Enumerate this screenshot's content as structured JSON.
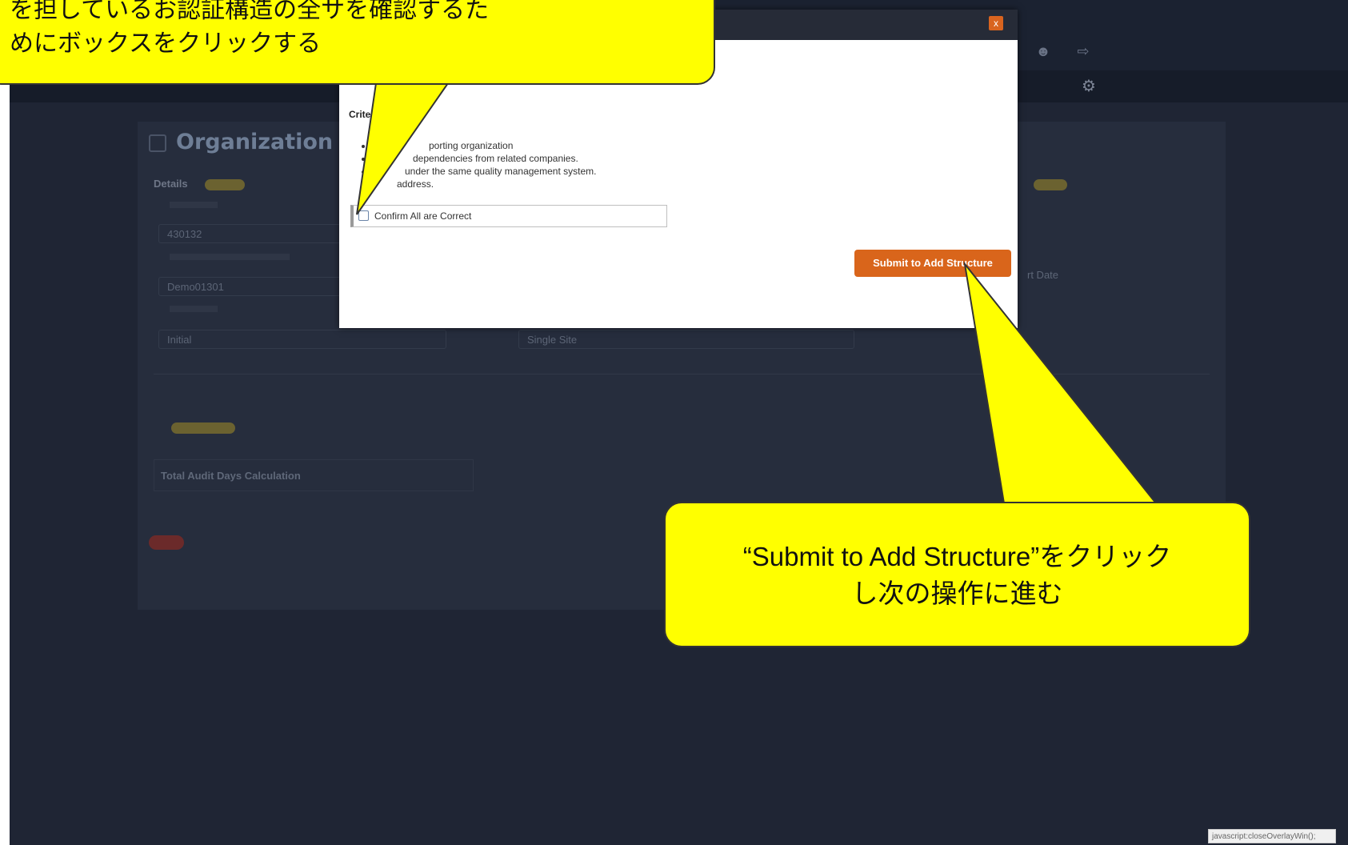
{
  "app": {
    "topbar_user": "",
    "panel_title": "Organization Aud",
    "details_label": "Details",
    "details_badge": "",
    "fields": [
      {
        "label": "",
        "value": "430132"
      },
      {
        "label": "",
        "value": "Demo01301"
      },
      {
        "label": "",
        "value": "Initial"
      }
    ],
    "single_site_value": "Single Site",
    "calc_label": "Total Audit Days Calculation",
    "right_text": "rt Date",
    "status_tooltip": "javascript:closeOverlayWin();"
  },
  "modal": {
    "header_title": "",
    "close_label": "x",
    "criteria_heading": "Criteria f",
    "criteria_items": [
      "porting organization",
      "dependencies from related companies.",
      "under the same quality management system.",
      "address."
    ],
    "confirm_label": "Confirm All are Correct",
    "confirm_checked": false,
    "submit_label": "Submit to Add Structure"
  },
  "annotations": {
    "top_callout_line1": "を担しているお認証構造の全サを確認するた",
    "top_callout_line2": "めにボックスをクリックする",
    "bottom_callout_line1": "“Submit to Add Structure”をクリック",
    "bottom_callout_line2": "し次の操作に進む",
    "callout_color": "#ffff00"
  },
  "colors": {
    "background": "#1f2534",
    "accent": "#d9651b"
  }
}
